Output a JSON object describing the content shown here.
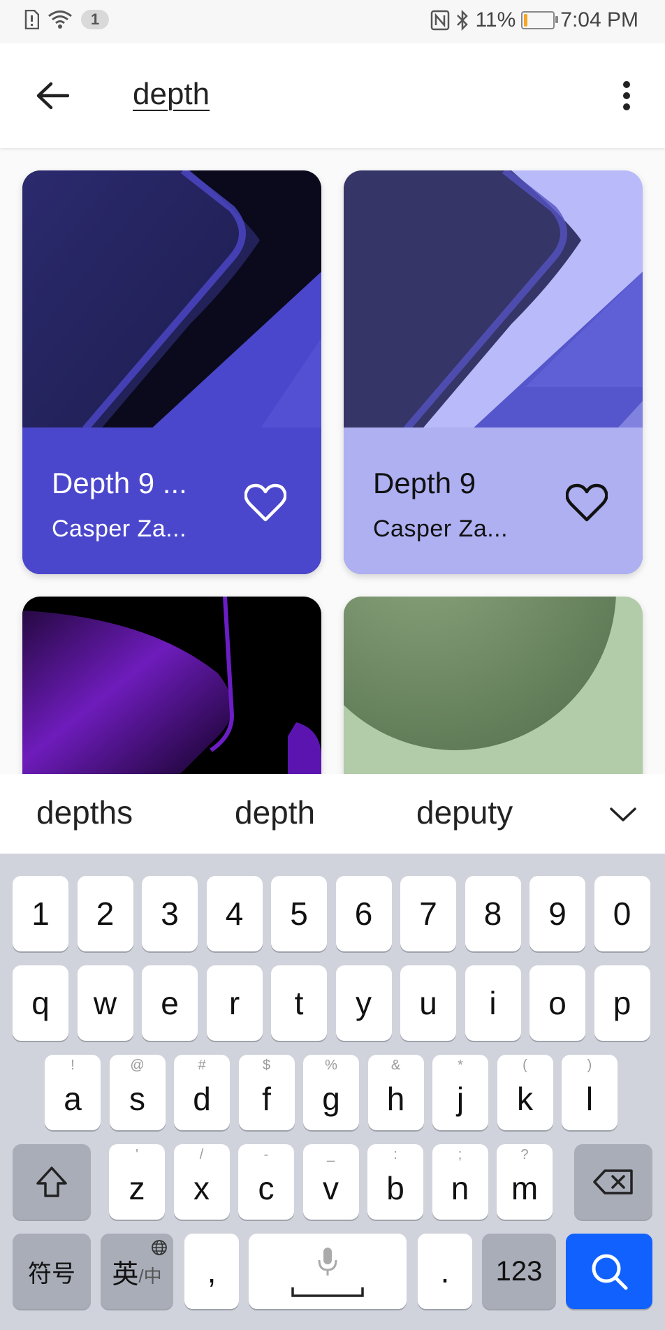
{
  "status_bar": {
    "notification_count": "1",
    "battery_percent": "11%",
    "battery_level": 0.11,
    "time": "7:04 PM",
    "icons": [
      "sim-alert-icon",
      "wifi-icon",
      "nfc-icon",
      "bluetooth-icon",
      "battery-icon"
    ]
  },
  "appbar": {
    "search_query": "depth",
    "back_icon": "arrow-left-icon",
    "more_icon": "more-vert-icon"
  },
  "results": [
    {
      "title": "Depth 9 ...",
      "author": "Casper Za...",
      "favorite_icon": "heart-outline-icon",
      "meta_color": "#4b47cc",
      "text_color": "#ffffff"
    },
    {
      "title": "Depth 9",
      "author": "Casper Za...",
      "favorite_icon": "heart-outline-icon",
      "meta_color": "#aeb0f1",
      "text_color": "#111111"
    }
  ],
  "suggestions": {
    "items": [
      "depths",
      "depth",
      "deputy"
    ],
    "expand_icon": "chevron-down-icon"
  },
  "keyboard": {
    "row_numbers": [
      "1",
      "2",
      "3",
      "4",
      "5",
      "6",
      "7",
      "8",
      "9",
      "0"
    ],
    "row_q": [
      "q",
      "w",
      "e",
      "r",
      "t",
      "y",
      "u",
      "i",
      "o",
      "p"
    ],
    "row_a": [
      {
        "main": "a",
        "sub": "!"
      },
      {
        "main": "s",
        "sub": "@"
      },
      {
        "main": "d",
        "sub": "#"
      },
      {
        "main": "f",
        "sub": "$"
      },
      {
        "main": "g",
        "sub": "%"
      },
      {
        "main": "h",
        "sub": "&"
      },
      {
        "main": "j",
        "sub": "*"
      },
      {
        "main": "k",
        "sub": "("
      },
      {
        "main": "l",
        "sub": ")"
      }
    ],
    "row_z": [
      {
        "main": "z",
        "sub": "'"
      },
      {
        "main": "x",
        "sub": "/"
      },
      {
        "main": "c",
        "sub": "-"
      },
      {
        "main": "v",
        "sub": "_"
      },
      {
        "main": "b",
        "sub": ":"
      },
      {
        "main": "n",
        "sub": ";"
      },
      {
        "main": "m",
        "sub": "?"
      }
    ],
    "symbols_label": "符号",
    "lang_label": "英",
    "lang_alt_label": "/中",
    "comma_label": ",",
    "period_label": ".",
    "numbers_label": "123",
    "accent_color": "#1161fe"
  }
}
